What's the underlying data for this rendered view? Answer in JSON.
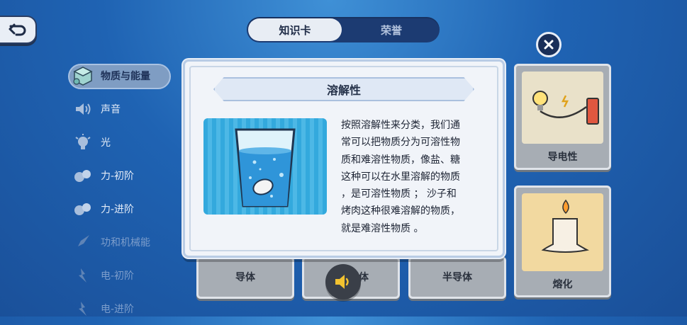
{
  "tabs": [
    {
      "label": "知识卡",
      "active": true
    },
    {
      "label": "荣誉",
      "active": false
    }
  ],
  "sidebar": {
    "items": [
      {
        "label": "物质与能量",
        "icon": "cube-icon",
        "state": "active"
      },
      {
        "label": "声音",
        "icon": "speaker-icon",
        "state": "normal"
      },
      {
        "label": "光",
        "icon": "light-bulb-icon",
        "state": "normal"
      },
      {
        "label": "力-初阶",
        "icon": "force-icon",
        "state": "normal"
      },
      {
        "label": "力-进阶",
        "icon": "force-icon",
        "state": "normal"
      },
      {
        "label": "功和机械能",
        "icon": "rocket-icon",
        "state": "dim"
      },
      {
        "label": "电-初阶",
        "icon": "lightning-icon",
        "state": "dim"
      },
      {
        "label": "电-进阶",
        "icon": "lightning-icon",
        "state": "dim"
      }
    ]
  },
  "cards": {
    "conductivity": "导电性",
    "melting": "熔化",
    "conductor": "导体",
    "insulator_partial": "体",
    "semiconductor": "半导体"
  },
  "modal": {
    "title": "溶解性",
    "image_icon": "glass-of-water-with-tablet-icon",
    "description": "按照溶解性来分类，我们通\n常可以把物质分为可溶性物\n质和难溶性物质，像盐、糖\n这种可以在水里溶解的物质\n，是可溶性物质 ； 沙子和\n烤肉这种很难溶解的物质，\n就是难溶性物质 。"
  },
  "colors": {
    "background": "#1f63b3",
    "modal_bg": "#f1f4f9",
    "card_bg": "#a7adb4",
    "active_tab": "#e8edf4"
  }
}
